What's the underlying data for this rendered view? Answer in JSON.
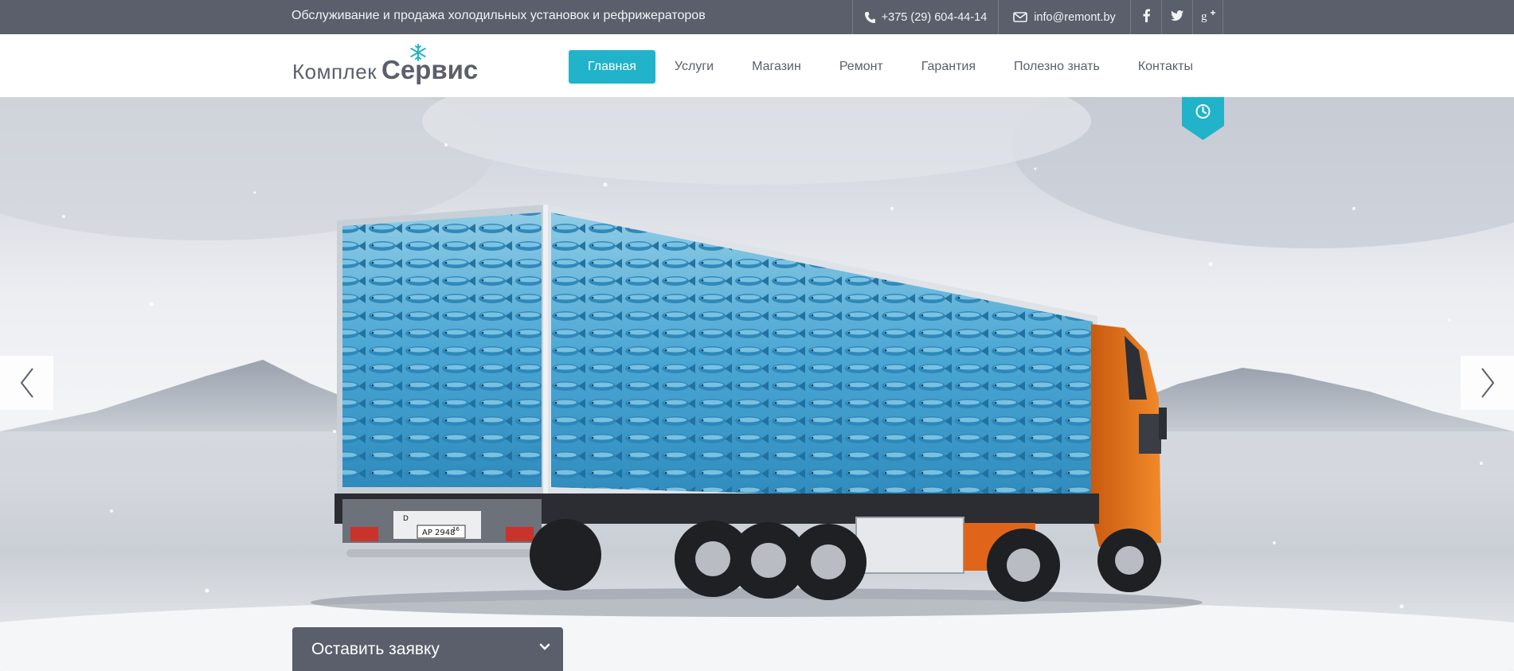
{
  "topbar": {
    "tagline": "Обслуживание и продажа холодильных установок и рефрижераторов",
    "phone": "+375 (29) 604-44-14",
    "email": "info@remont.by",
    "social": [
      "facebook-icon",
      "twitter-icon",
      "google-plus-icon"
    ]
  },
  "logo": {
    "part1": "Комплек",
    "part2": "Сервис"
  },
  "nav": {
    "items": [
      {
        "label": "Главная",
        "active": true
      },
      {
        "label": "Услуги"
      },
      {
        "label": "Магазин"
      },
      {
        "label": "Ремонт"
      },
      {
        "label": "Гарантия"
      },
      {
        "label": "Полезно знать"
      },
      {
        "label": "Контакты"
      }
    ]
  },
  "hero": {
    "plate": "AP 2948",
    "plate_region": "16",
    "plate_small": "D"
  },
  "request": {
    "label": "Оставить заявку"
  },
  "colors": {
    "accent": "#20b3c9",
    "dark": "#5a5f6b",
    "truck_orange": "#f07a1c",
    "fish_blue": "#2a8fc0"
  }
}
